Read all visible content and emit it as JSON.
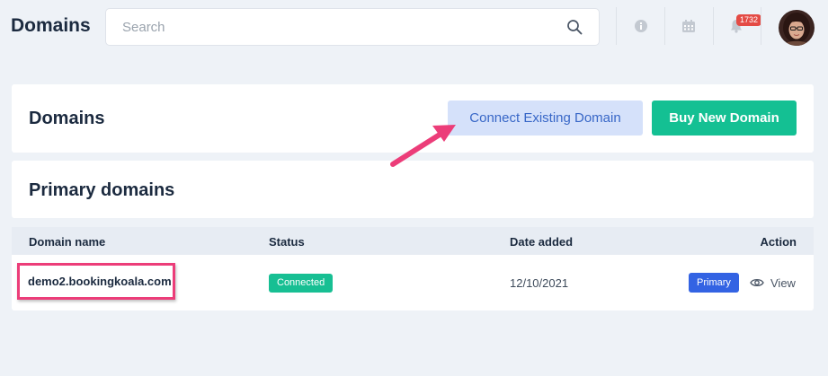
{
  "header": {
    "title": "Domains",
    "search": {
      "placeholder": "Search",
      "value": ""
    },
    "notifications": {
      "count": "1732"
    },
    "icons": [
      "search-icon",
      "info-icon",
      "calendar-icon",
      "bell-icon"
    ]
  },
  "domains_card": {
    "title": "Domains",
    "connect_label": "Connect Existing Domain",
    "buy_label": "Buy New Domain"
  },
  "primary_card": {
    "title": "Primary domains"
  },
  "table": {
    "columns": [
      "Domain name",
      "Status",
      "Date added",
      "Action"
    ],
    "rows": [
      {
        "domain": "demo2.bookingkoala.com",
        "status": "Connected",
        "date_added": "12/10/2021",
        "badge": "Primary",
        "action": "View"
      }
    ]
  },
  "colors": {
    "accent_green": "#14c093",
    "connect_bg": "#d5e1fa",
    "primary_blue": "#3363e3",
    "highlight_pink": "#ec3d79",
    "badge_red": "#e44b45"
  }
}
